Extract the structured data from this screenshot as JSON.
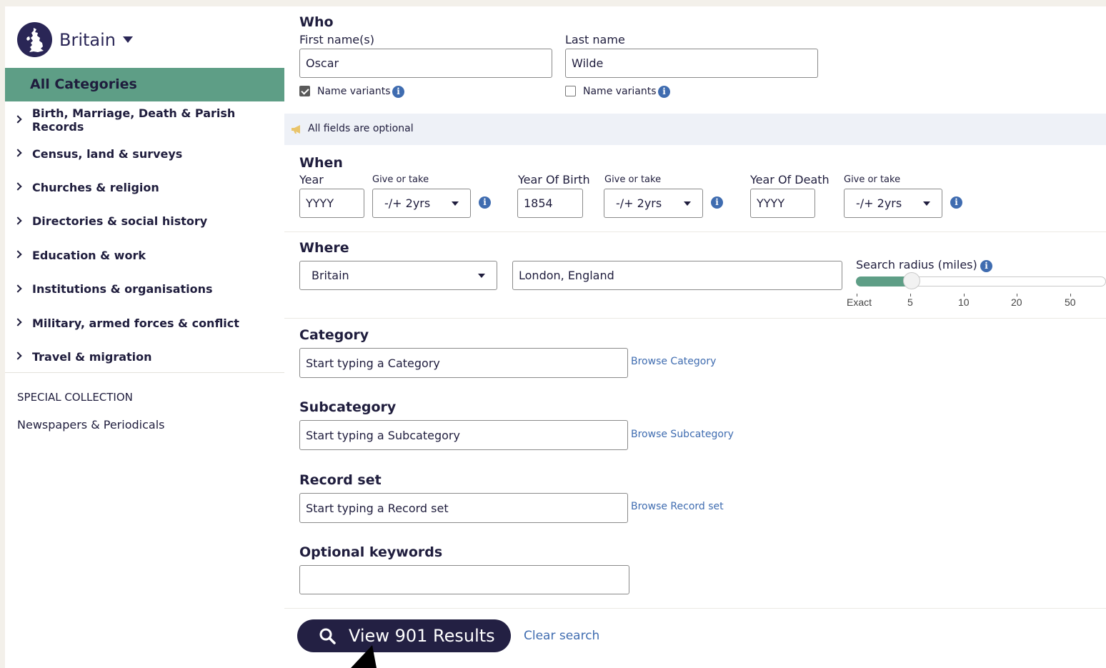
{
  "sidebar": {
    "region": "Britain",
    "all_categories": "All Categories",
    "categories": [
      {
        "label": "Birth, Marriage, Death & Parish Records"
      },
      {
        "label": "Census, land & surveys"
      },
      {
        "label": "Churches & religion"
      },
      {
        "label": "Directories & social history"
      },
      {
        "label": "Education & work"
      },
      {
        "label": "Institutions & organisations"
      },
      {
        "label": "Military, armed forces & conflict"
      },
      {
        "label": "Travel & migration"
      }
    ],
    "special_collection_title": "SPECIAL COLLECTION",
    "special_collection_item": "Newspapers & Periodicals"
  },
  "who": {
    "title": "Who",
    "first_name_label": "First name(s)",
    "first_name_value": "Oscar",
    "last_name_label": "Last name",
    "last_name_value": "Wilde",
    "name_variants_label": "Name variants",
    "first_name_variants_checked": true,
    "last_name_variants_checked": false
  },
  "optional_note": "All fields are optional",
  "when": {
    "title": "When",
    "year_label": "Year",
    "give_or_take_label": "Give or take",
    "year_placeholder": "YYYY",
    "year_range": "-/+ 2yrs",
    "birth_label": "Year Of Birth",
    "birth_value": "1854",
    "birth_range": "-/+ 2yrs",
    "death_label": "Year Of Death",
    "death_placeholder": "YYYY",
    "death_range": "-/+ 2yrs"
  },
  "where": {
    "title": "Where",
    "country": "Britain",
    "place_value": "London, England",
    "radius_label": "Search radius (miles)",
    "radius_ticks": [
      "Exact",
      "5",
      "10",
      "20",
      "50"
    ],
    "radius_selected": "5"
  },
  "category": {
    "title": "Category",
    "placeholder": "Start typing a Category",
    "browse": "Browse Category"
  },
  "subcategory": {
    "title": "Subcategory",
    "placeholder": "Start typing a Subcategory",
    "browse": "Browse Subcategory"
  },
  "record_set": {
    "title": "Record set",
    "placeholder": "Start typing a Record set",
    "browse": "Browse Record set"
  },
  "keywords": {
    "title": "Optional keywords",
    "value": ""
  },
  "actions": {
    "search_label": "View 901 Results",
    "clear_label": "Clear search"
  },
  "colors": {
    "brand_dark": "#232043",
    "accent_green": "#5e9e86",
    "link_blue": "#3f6cb0",
    "info_bar": "#eef1f7"
  }
}
